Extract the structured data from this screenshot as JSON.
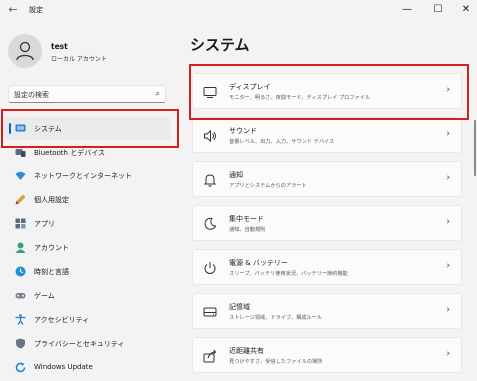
{
  "window": {
    "title": "設定",
    "back_glyph": "←",
    "minimize_glyph": "—",
    "maximize_glyph": "☐",
    "close_glyph": "✕"
  },
  "profile": {
    "name": "test",
    "account_type": "ローカル アカウント"
  },
  "search": {
    "placeholder": "設定の検索",
    "icon": "search-icon"
  },
  "sidebar": {
    "items": [
      {
        "label": "システム",
        "icon": "system-icon",
        "selected": true
      },
      {
        "label": "Bluetooth とデバイス",
        "icon": "bluetooth-icon"
      },
      {
        "label": "ネットワークとインターネット",
        "icon": "network-icon"
      },
      {
        "label": "個人用設定",
        "icon": "personalization-icon"
      },
      {
        "label": "アプリ",
        "icon": "apps-icon"
      },
      {
        "label": "アカウント",
        "icon": "accounts-icon"
      },
      {
        "label": "時刻と言語",
        "icon": "time-language-icon"
      },
      {
        "label": "ゲーム",
        "icon": "gaming-icon"
      },
      {
        "label": "アクセシビリティ",
        "icon": "accessibility-icon"
      },
      {
        "label": "プライバシーとセキュリティ",
        "icon": "privacy-icon"
      },
      {
        "label": "Windows Update",
        "icon": "windows-update-icon"
      }
    ]
  },
  "main": {
    "heading": "システム",
    "cards": [
      {
        "title": "ディスプレイ",
        "subtitle": "モニター、明るさ、夜間モード、ディスプレイ プロファイル",
        "icon": "display-icon"
      },
      {
        "title": "サウンド",
        "subtitle": "音量レベル、出力、入力、サウンド デバイス",
        "icon": "sound-icon"
      },
      {
        "title": "通知",
        "subtitle": "アプリとシステムからのアラート",
        "icon": "notifications-icon"
      },
      {
        "title": "集中モード",
        "subtitle": "通知、自動規則",
        "icon": "focus-icon"
      },
      {
        "title": "電源 & バッテリー",
        "subtitle": "スリープ、バッテリ使用状況、バッテリー節約機能",
        "icon": "power-icon"
      },
      {
        "title": "記憶域",
        "subtitle": "ストレージ領域、ドライブ、構成ルール",
        "icon": "storage-icon"
      },
      {
        "title": "近距離共有",
        "subtitle": "見つけやすさ、受信したファイルの場所",
        "icon": "nearby-sharing-icon"
      }
    ],
    "chevron": "›"
  },
  "colors": {
    "accent": "#0067c0",
    "highlight_box": "#d31f1f",
    "background": "#f3f3f3",
    "card": "#fbfbfb"
  }
}
